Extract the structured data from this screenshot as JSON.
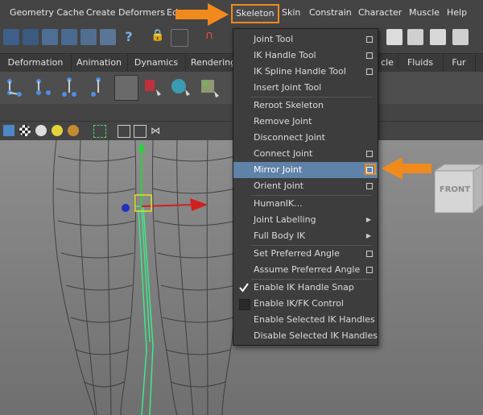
{
  "menubar": {
    "items": [
      "Geometry Cache",
      "Create Deformers",
      "Ed",
      "Skeleton",
      "Skin",
      "Constrain",
      "Character",
      "Muscle",
      "Help"
    ]
  },
  "shelf_tabs": [
    "Deformation",
    "Animation",
    "Dynamics",
    "Rendering",
    "cle",
    "Fluids",
    "Fur"
  ],
  "skeleton_menu": {
    "items": [
      {
        "label": "Joint Tool",
        "option_box": true
      },
      {
        "label": "IK Handle Tool",
        "option_box": true
      },
      {
        "label": "IK Spline Handle Tool",
        "option_box": true
      },
      {
        "label": "Insert Joint Tool",
        "option_box": false
      },
      {
        "label": "Reroot Skeleton",
        "option_box": false
      },
      {
        "label": "Remove Joint",
        "option_box": false
      },
      {
        "label": "Disconnect Joint",
        "option_box": false
      },
      {
        "label": "Connect Joint",
        "option_box": true
      },
      {
        "label": "Mirror Joint",
        "option_box": true
      },
      {
        "label": "Orient Joint",
        "option_box": true
      },
      {
        "label": "HumanIK...",
        "option_box": false
      },
      {
        "label": "Joint Labelling",
        "option_box": false
      },
      {
        "label": "Full Body IK",
        "option_box": false
      },
      {
        "label": "Set Preferred Angle",
        "option_box": true
      },
      {
        "label": "Assume Preferred Angle",
        "option_box": true
      },
      {
        "label": "Enable IK Handle Snap",
        "checked": true
      },
      {
        "label": "Enable IK/FK Control",
        "checked": false
      },
      {
        "label": "Enable Selected IK Handles",
        "option_box": false
      },
      {
        "label": "Disable Selected IK Handles",
        "option_box": false
      }
    ]
  },
  "viewcube": {
    "face_label": "FRONT"
  },
  "colors": {
    "highlight": "#5f82a8",
    "callout": "#f08a1c"
  }
}
